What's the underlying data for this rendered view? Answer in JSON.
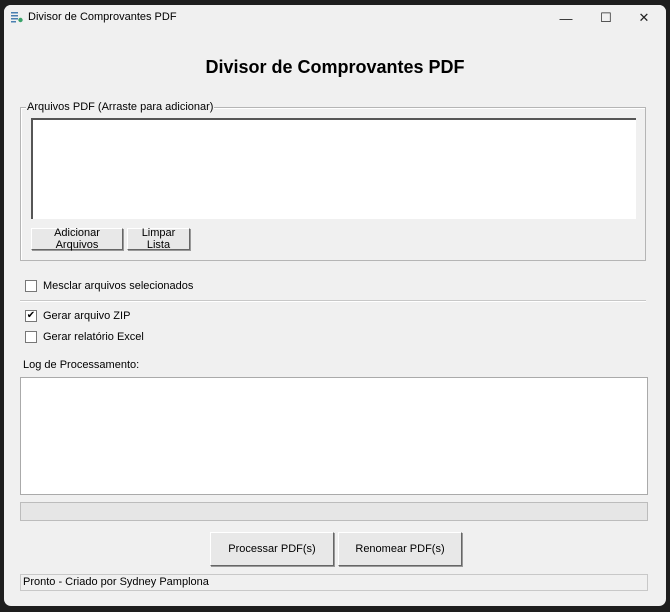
{
  "window": {
    "title": "Divisor de Comprovantes PDF",
    "controls": {
      "minimize": "—",
      "maximize": "☐",
      "close": "✕"
    }
  },
  "heading": "Divisor de Comprovantes PDF",
  "files_group": {
    "label": "Arquivos PDF (Arraste para adicionar)",
    "add_button": "Adicionar Arquivos",
    "clear_button": "Limpar Lista",
    "items": []
  },
  "options": {
    "merge": {
      "label": "Mesclar arquivos selecionados",
      "checked": false
    },
    "zip": {
      "label": "Gerar arquivo ZIP",
      "checked": true,
      "mark": "✔"
    },
    "excel": {
      "label": "Gerar relatório Excel",
      "checked": false
    }
  },
  "log": {
    "label": "Log de Processamento:",
    "content": ""
  },
  "progress": {
    "value": 0
  },
  "actions": {
    "process": "Processar PDF(s)",
    "rename": "Renomear PDF(s)"
  },
  "status": "Pronto - Criado por Sydney Pamplona"
}
